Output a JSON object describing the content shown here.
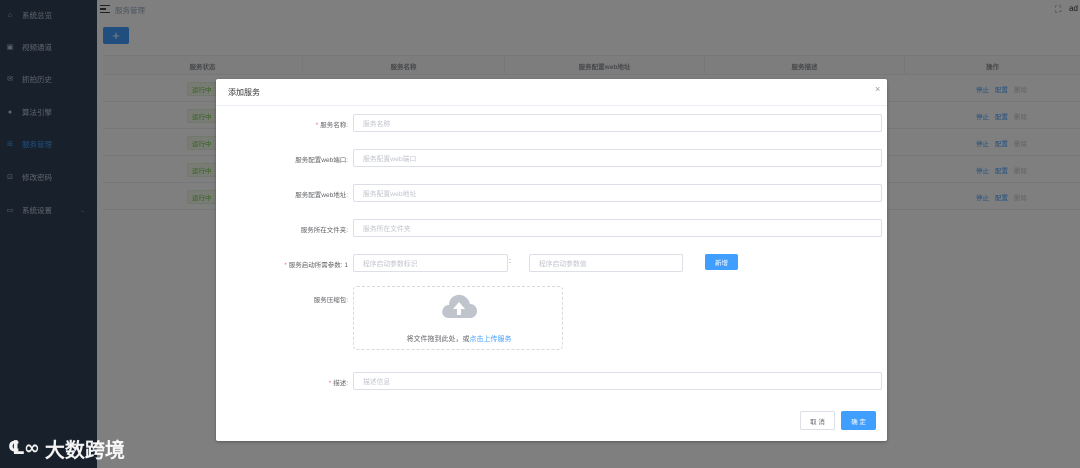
{
  "sidebar": {
    "items": [
      {
        "label": "系统总览",
        "icon": "home-icon"
      },
      {
        "label": "视频通道",
        "icon": "video-icon"
      },
      {
        "label": "抓拍历史",
        "icon": "history-icon"
      },
      {
        "label": "算法引擎",
        "icon": "engine-icon"
      },
      {
        "label": "服务管理",
        "icon": "grid-icon"
      },
      {
        "label": "修改密码",
        "icon": "lock-icon"
      },
      {
        "label": "系统设置",
        "icon": "settings-icon"
      }
    ],
    "active_index": 4
  },
  "watermark": {
    "text": "大数跨境"
  },
  "header": {
    "breadcrumb": "服务管理",
    "user": "ad"
  },
  "toolbar": {
    "add_label": "+"
  },
  "table": {
    "columns": [
      "服务状态",
      "服务名称",
      "服务配置web地址",
      "服务描述",
      "操作"
    ],
    "rows": [
      {
        "status": "运行中"
      },
      {
        "status": "运行中"
      },
      {
        "status": "运行中"
      },
      {
        "status": "运行中"
      },
      {
        "status": "运行中"
      }
    ],
    "actions": {
      "stop": "停止",
      "config": "配置",
      "delete": "删除"
    }
  },
  "dialog": {
    "title": "添加服务",
    "close": "×",
    "fields": {
      "name": {
        "label": "服务名称:",
        "placeholder": "服务名称"
      },
      "web_port": {
        "label": "服务配置web端口:",
        "placeholder": "服务配置web端口"
      },
      "web_addr": {
        "label": "服务配置web地址:",
        "placeholder": "服务配置web地址"
      },
      "folder": {
        "label": "服务所在文件夹:",
        "placeholder": "服务所在文件夹"
      },
      "params": {
        "label": "服务启动所需参数: 1",
        "key_placeholder": "程序启动参数标识",
        "colon": ":",
        "value_placeholder": "程序启动参数值",
        "add_label": "新增"
      },
      "package": {
        "label": "服务压缩包:",
        "hint": "将文件拖到此处，或",
        "link": "点击上传服务"
      },
      "desc": {
        "label": "描述:",
        "placeholder": "描述信息"
      }
    },
    "cancel_label": "取 消",
    "ok_label": "确 定"
  },
  "colors": {
    "primary": "#409eff",
    "sidebar_bg": "#304156",
    "success": "#67c23a",
    "danger": "#f56c6c"
  }
}
